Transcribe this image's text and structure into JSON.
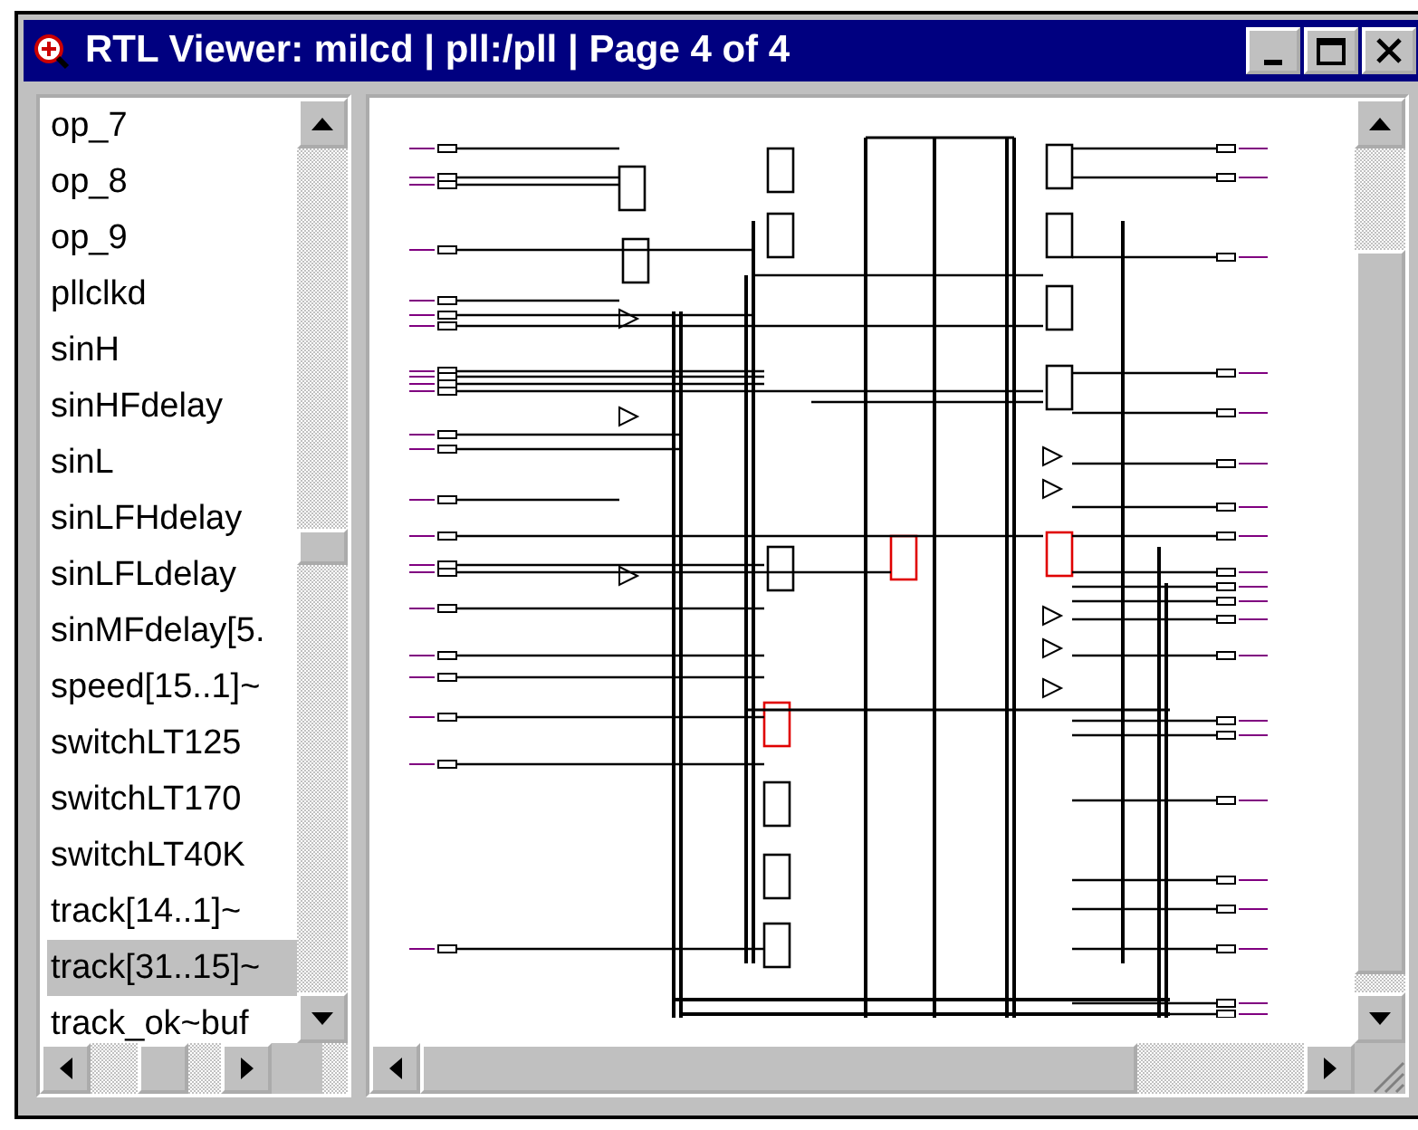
{
  "window": {
    "title": "RTL Viewer: milcd | pll:/pll | Page 4 of 4"
  },
  "node_list": {
    "items": [
      {
        "label": "op_7",
        "selected": false
      },
      {
        "label": "op_8",
        "selected": false
      },
      {
        "label": "op_9",
        "selected": false
      },
      {
        "label": "pllclkd",
        "selected": false
      },
      {
        "label": "sinH",
        "selected": false
      },
      {
        "label": "sinHFdelay",
        "selected": false
      },
      {
        "label": "sinL",
        "selected": false
      },
      {
        "label": "sinLFHdelay",
        "selected": false
      },
      {
        "label": "sinLFLdelay",
        "selected": false
      },
      {
        "label": "sinMFdelay[5.",
        "selected": false
      },
      {
        "label": "speed[15..1]~",
        "selected": false
      },
      {
        "label": "switchLT125",
        "selected": false
      },
      {
        "label": "switchLT170",
        "selected": false
      },
      {
        "label": "switchLT40K",
        "selected": false
      },
      {
        "label": "track[14..1]~",
        "selected": false
      },
      {
        "label": "track[31..15]~",
        "selected": true
      },
      {
        "label": "track_ok~buf",
        "selected": false
      }
    ]
  }
}
